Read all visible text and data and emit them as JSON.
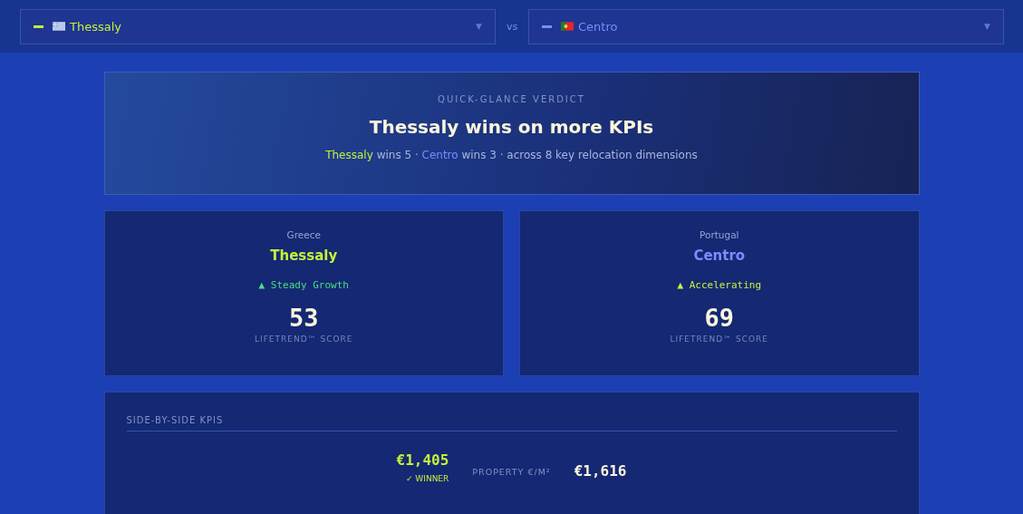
{
  "selectors": [
    {
      "kind": "greece",
      "name": "Thessaly",
      "color": "#c4f03a",
      "caret": "▼"
    },
    {
      "kind": "portugal",
      "name": "Centro",
      "color": "#7b8cff",
      "caret": "▼"
    }
  ],
  "vs_label": "vs",
  "verdict": {
    "eyebrow": "QUICK-GLANCE VERDICT",
    "headline": "Thessaly wins on more KPIs",
    "summary": [
      {
        "text": "Thessaly",
        "color": "#c4f03a"
      },
      {
        "text": "wins 5 ·"
      },
      {
        "text": "Centro",
        "color": "#7b8cff"
      },
      {
        "text": "wins 3 · across 8 key relocation dimensions"
      }
    ]
  },
  "regions": [
    {
      "country": "Greece",
      "name": "Thessaly",
      "trend": "▲ Steady Growth",
      "color": "#4ade80",
      "score": "53",
      "score_label": "LIFETREND™ SCORE"
    },
    {
      "country": "Portugal",
      "name": "Centro",
      "trend": "▲ Accelerating",
      "color": "#c4f03a",
      "score": "69",
      "score_label": "LIFETREND™ SCORE"
    }
  ],
  "kpis": {
    "title": "SIDE-BY-SIDE KPIS",
    "rows": [
      {
        "label": "PROPERTY €/M²",
        "values": [
          {
            "value": "€1,405",
            "winner": true,
            "badge": "✓ WINNER"
          },
          {
            "value": "€1,616",
            "winner": false
          }
        ]
      }
    ]
  }
}
